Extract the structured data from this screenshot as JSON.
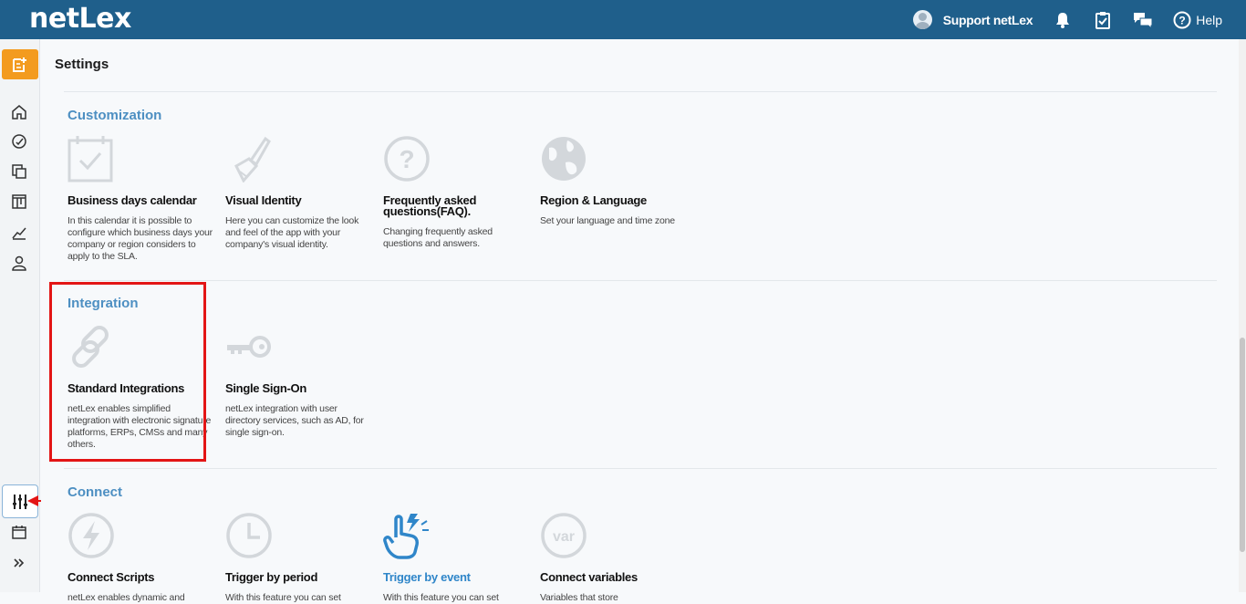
{
  "app": {
    "logo": "netLex"
  },
  "header": {
    "user_name": "Support netLex",
    "help_label": "Help"
  },
  "page": {
    "title": "Settings"
  },
  "sections": [
    {
      "title": "Customization",
      "cards": [
        {
          "title": "Business days calendar",
          "desc": "In this calendar it is possible to configure which business days your company or region considers to apply to the SLA.",
          "icon": "calendar-check-icon"
        },
        {
          "title": "Visual Identity",
          "desc": "Here you can customize the look and feel of the app with your company's visual identity.",
          "icon": "paintbrush-icon"
        },
        {
          "title": "Frequently asked questions(FAQ).",
          "desc": "Changing frequently asked questions and answers.",
          "icon": "question-circle-icon"
        },
        {
          "title": "Region & Language",
          "desc": "Set your language and time zone",
          "icon": "globe-icon"
        }
      ]
    },
    {
      "title": "Integration",
      "cards": [
        {
          "title": "Standard Integrations",
          "desc": "netLex enables simplified integration with electronic signature platforms, ERPs, CMSs and many others.",
          "icon": "link-chain-icon"
        },
        {
          "title": "Single Sign-On",
          "desc": "netLex integration with user directory services, such as AD, for single sign-on.",
          "icon": "key-icon"
        }
      ]
    },
    {
      "title": "Connect",
      "cards": [
        {
          "title": "Connect Scripts",
          "desc": "netLex enables dynamic and",
          "icon": "lightning-icon"
        },
        {
          "title": "Trigger by period",
          "desc": "With this feature you can set",
          "icon": "clock-icon"
        },
        {
          "title": "Trigger by event",
          "desc": "With this feature you can set",
          "icon": "hand-tap-icon"
        },
        {
          "title": "Connect variables",
          "desc": "Variables that store",
          "icon": "var-icon"
        }
      ]
    }
  ],
  "colors": {
    "header_bg": "#1f5f8b",
    "accent": "#4d8fc2",
    "new_button": "#f39b1f",
    "highlight": "#e31515"
  }
}
